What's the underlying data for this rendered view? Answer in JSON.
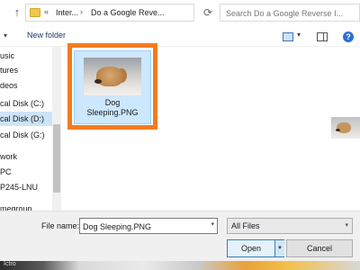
{
  "address_bar": {
    "overflow": "«",
    "crumbs": [
      "Inter...",
      "Do a Google Reve..."
    ],
    "search_placeholder": "Search Do a Google Reverse I..."
  },
  "toolbar": {
    "organize_tail": "▾",
    "new_folder": "New folder",
    "help": "?"
  },
  "nav_pane": {
    "items": [
      "usic",
      "tures",
      "deos",
      "cal Disk (C:)",
      "cal Disk (D:)",
      "cal Disk (G:)",
      "work",
      "PC",
      "P245-LNU",
      "megroup"
    ],
    "selected_index": 4
  },
  "content": {
    "file": {
      "name_line1": "Dog",
      "name_line2": "Sleeping.PNG"
    }
  },
  "bottom": {
    "file_name_label": "File name:",
    "file_name_value": "Dog Sleeping.PNG",
    "filter_value": "All Files",
    "open_label": "Open",
    "cancel_label": "Cancel"
  },
  "strip": {
    "text": "Ictro"
  },
  "colors": {
    "highlight": "#f47b20",
    "selection": "#cce8ff",
    "accent": "#2d6fd1"
  }
}
